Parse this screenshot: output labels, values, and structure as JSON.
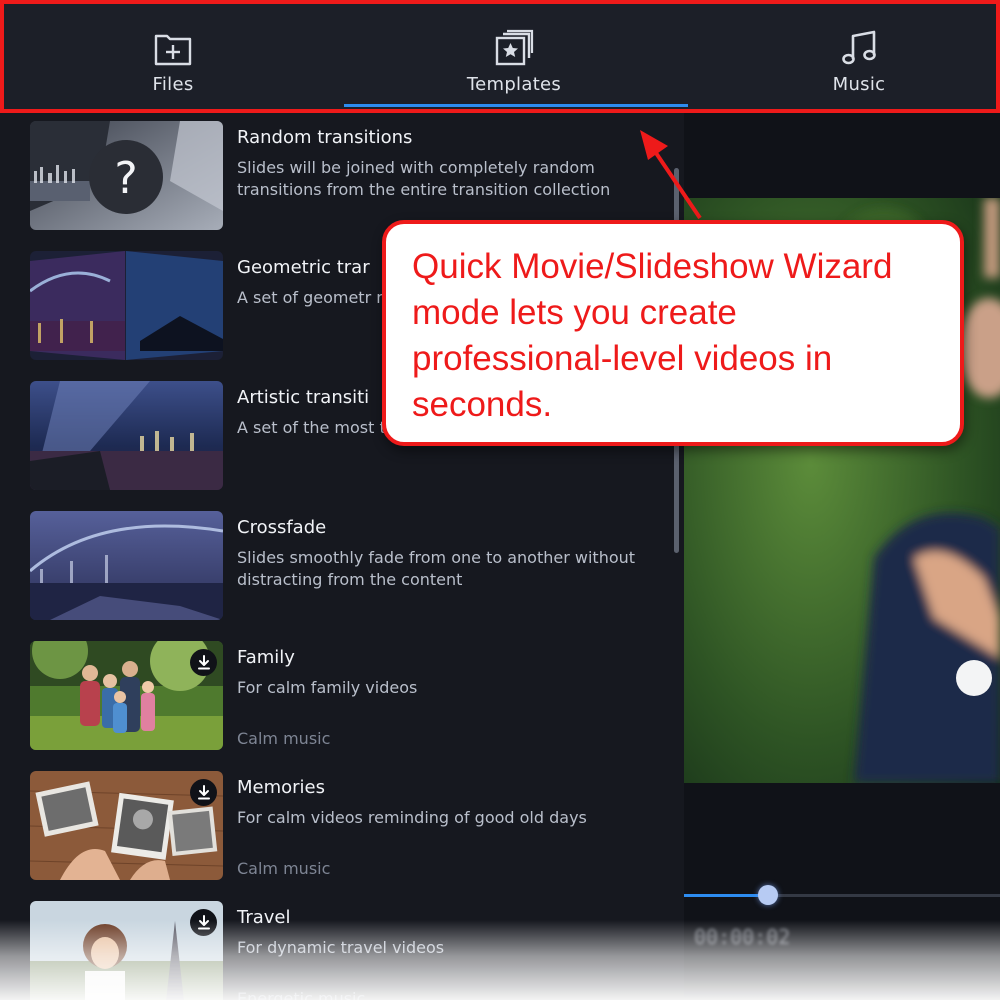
{
  "tabs": [
    {
      "label": "Files",
      "icon": "folder-plus-icon"
    },
    {
      "label": "Templates",
      "icon": "star-stack-icon",
      "active": true
    },
    {
      "label": "Music",
      "icon": "music-note-icon"
    }
  ],
  "items": [
    {
      "title": "Random transitions",
      "description": "Slides will be joined with completely random transitions from the entire transition collection",
      "music": "",
      "downloadable": false
    },
    {
      "title": "Geometric trar",
      "description": "A set of geometr modern, avant-g",
      "music": "",
      "downloadable": false
    },
    {
      "title": "Artistic transiti",
      "description": "A set of the most transitions",
      "music": "",
      "downloadable": false
    },
    {
      "title": "Crossfade",
      "description": "Slides smoothly fade from one to another without distracting from the content",
      "music": "",
      "downloadable": false
    },
    {
      "title": "Family",
      "description": "For calm family videos",
      "music": "Calm music",
      "downloadable": true
    },
    {
      "title": "Memories",
      "description": "For calm videos reminding of good old days",
      "music": "Calm music",
      "downloadable": true
    },
    {
      "title": "Travel",
      "description": "For dynamic travel videos",
      "music": "Energetic music",
      "downloadable": true
    }
  ],
  "preview": {
    "timecode": "00:00:02",
    "progress": 0.27
  },
  "callout": {
    "text": "Quick Movie/Slideshow Wizard mode lets you create professional-level videos in seconds."
  },
  "colors": {
    "accent": "#2d8cf0",
    "annotation": "#ee1a1a",
    "background": "#16181f"
  }
}
